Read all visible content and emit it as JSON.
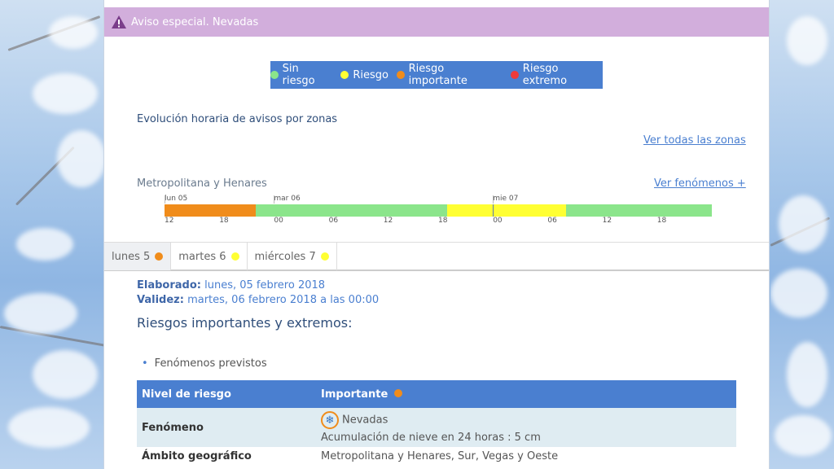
{
  "alert": {
    "text": "Aviso especial. Nevadas"
  },
  "legend": [
    {
      "label": "Sin riesgo",
      "color": "#8be58b"
    },
    {
      "label": "Riesgo",
      "color": "#ffff33"
    },
    {
      "label": "Riesgo importante",
      "color": "#f08c1b"
    },
    {
      "label": "Riesgo extremo",
      "color": "#ee3b3b"
    }
  ],
  "section_title": "Evolución horaria de avisos por zonas",
  "links": {
    "all_zones": "Ver todas las zonas",
    "phenomena": "Ver fenómenos +"
  },
  "zone": {
    "name": "Metropolitana y Henares",
    "days": [
      "lun 05",
      "mar 06",
      "mie 07"
    ],
    "hours": [
      "12",
      "18",
      "00",
      "06",
      "12",
      "18",
      "00",
      "06",
      "12",
      "18"
    ],
    "segments": [
      {
        "from_hour": 0,
        "to_hour": 10,
        "level": "Riesgo importante"
      },
      {
        "from_hour": 10,
        "to_hour": 31,
        "level": "Sin riesgo"
      },
      {
        "from_hour": 31,
        "to_hour": 44,
        "level": "Riesgo"
      },
      {
        "from_hour": 44,
        "to_hour": 60,
        "level": "Sin riesgo"
      }
    ]
  },
  "tabs": [
    {
      "label": "lunes 5",
      "color": "#f08c1b",
      "active": true
    },
    {
      "label": "martes 6",
      "color": "#ffff33",
      "active": false
    },
    {
      "label": "miércoles 7",
      "color": "#ffff33",
      "active": false
    }
  ],
  "meta": {
    "elaborado_label": "Elaborado:",
    "elaborado_value": "lunes, 05 febrero 2018",
    "validez_label": "Validez:",
    "validez_value": "martes, 06 febrero 2018 a las 00:00"
  },
  "heading": "Riesgos importantes y extremos:",
  "bullet": "Fenómenos previstos",
  "table": {
    "header": {
      "label": "Nivel de riesgo",
      "value": "Importante",
      "value_color": "#f08c1b"
    },
    "phenomenon": {
      "label": "Fenómeno",
      "name": "Nevadas",
      "detail": "Acumulación de nieve en 24 horas : 5 cm",
      "icon": "snowflake-icon"
    },
    "scope": {
      "label": "Ámbito geográfico",
      "value": "Metropolitana y Henares, Sur, Vegas y Oeste"
    }
  }
}
